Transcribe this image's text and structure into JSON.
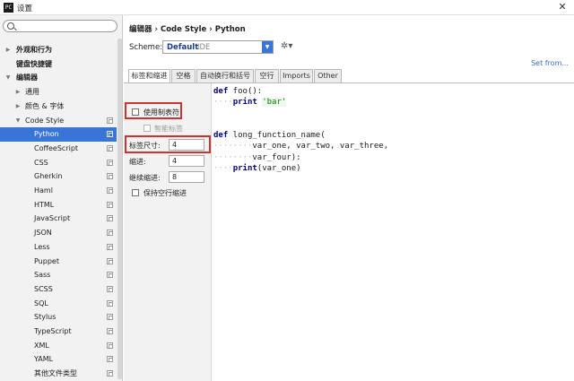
{
  "window": {
    "title": "设置",
    "icon": "pycharm-icon",
    "close": "✕"
  },
  "tree": {
    "search": {
      "value": "",
      "placeholder": ""
    },
    "items": [
      {
        "label": "外观和行为",
        "arrow": "▶",
        "bold": true
      },
      {
        "label": "键盘快捷键",
        "arrow": "",
        "bold": true
      },
      {
        "label": "编辑器",
        "arrow": "▼",
        "bold": true
      },
      {
        "label": "通用",
        "arrow": "▶"
      },
      {
        "label": "颜色 & 字体",
        "arrow": "▶"
      },
      {
        "label": "Code Style",
        "arrow": "▼",
        "cfg": true
      },
      {
        "label": "Python",
        "arrow": "",
        "cfg": true,
        "selected": true
      },
      {
        "label": "CoffeeScript",
        "arrow": "",
        "cfg": true
      },
      {
        "label": "CSS",
        "arrow": "",
        "cfg": true
      },
      {
        "label": "Gherkin",
        "arrow": "",
        "cfg": true
      },
      {
        "label": "Haml",
        "arrow": "",
        "cfg": true
      },
      {
        "label": "HTML",
        "arrow": "",
        "cfg": true
      },
      {
        "label": "JavaScript",
        "arrow": "",
        "cfg": true
      },
      {
        "label": "JSON",
        "arrow": "",
        "cfg": true
      },
      {
        "label": "Less",
        "arrow": "",
        "cfg": true
      },
      {
        "label": "Puppet",
        "arrow": "",
        "cfg": true
      },
      {
        "label": "Sass",
        "arrow": "",
        "cfg": true
      },
      {
        "label": "SCSS",
        "arrow": "",
        "cfg": true
      },
      {
        "label": "SQL",
        "arrow": "",
        "cfg": true
      },
      {
        "label": "Stylus",
        "arrow": "",
        "cfg": true
      },
      {
        "label": "TypeScript",
        "arrow": "",
        "cfg": true
      },
      {
        "label": "XML",
        "arrow": "",
        "cfg": true
      },
      {
        "label": "YAML",
        "arrow": "",
        "cfg": true
      },
      {
        "label": "其他文件类型",
        "arrow": "",
        "cfg": true
      }
    ]
  },
  "header": {
    "breadcrumb": [
      "编辑器",
      "Code Style",
      "Python"
    ],
    "breadcrumb_sep": "›",
    "scheme_label": "Scheme:",
    "scheme_value": "Default",
    "scheme_sub": "IDE",
    "scheme_arrow": "▼",
    "gear": "✲▾",
    "set_from": "Set from..."
  },
  "tabs": [
    "标签和缩进",
    "空格",
    "自动换行和括号",
    "空行",
    "Imports",
    "Other"
  ],
  "options": {
    "use_tab": {
      "label": "使用制表符",
      "checked": false
    },
    "smart_tabs": {
      "label": "智能标签",
      "checked": false,
      "disabled": true
    },
    "tab_size": {
      "label": "标签尺寸:",
      "value": "4"
    },
    "indent": {
      "label": "缩进:",
      "value": "4"
    },
    "continuation": {
      "label": "继续缩进:",
      "value": "8"
    },
    "keep_indents": {
      "label": "保持空行缩进",
      "checked": false
    }
  },
  "code_preview": {
    "lines": [
      [
        {
          "t": "def",
          "c": "kw"
        },
        {
          "t": " foo():",
          "c": ""
        }
      ],
      [
        {
          "t": "····",
          "c": "ws"
        },
        {
          "t": "print",
          "c": "kw"
        },
        {
          "t": " ",
          "c": ""
        },
        {
          "t": "'bar'",
          "c": "str"
        }
      ],
      [],
      [],
      [
        {
          "t": "def",
          "c": "kw"
        },
        {
          "t": " long_function_name(",
          "c": ""
        }
      ],
      [
        {
          "t": "········",
          "c": "ws"
        },
        {
          "t": "var_one, var_two, var_three,",
          "c": ""
        }
      ],
      [
        {
          "t": "········",
          "c": "ws"
        },
        {
          "t": "var_four):",
          "c": ""
        }
      ],
      [
        {
          "t": "····",
          "c": "ws"
        },
        {
          "t": "print",
          "c": "kw"
        },
        {
          "t": "(var_one)",
          "c": ""
        }
      ]
    ]
  },
  "colors": {
    "selection": "#3875d7",
    "highlight": "#d0322e",
    "link": "#3a6bb8"
  }
}
